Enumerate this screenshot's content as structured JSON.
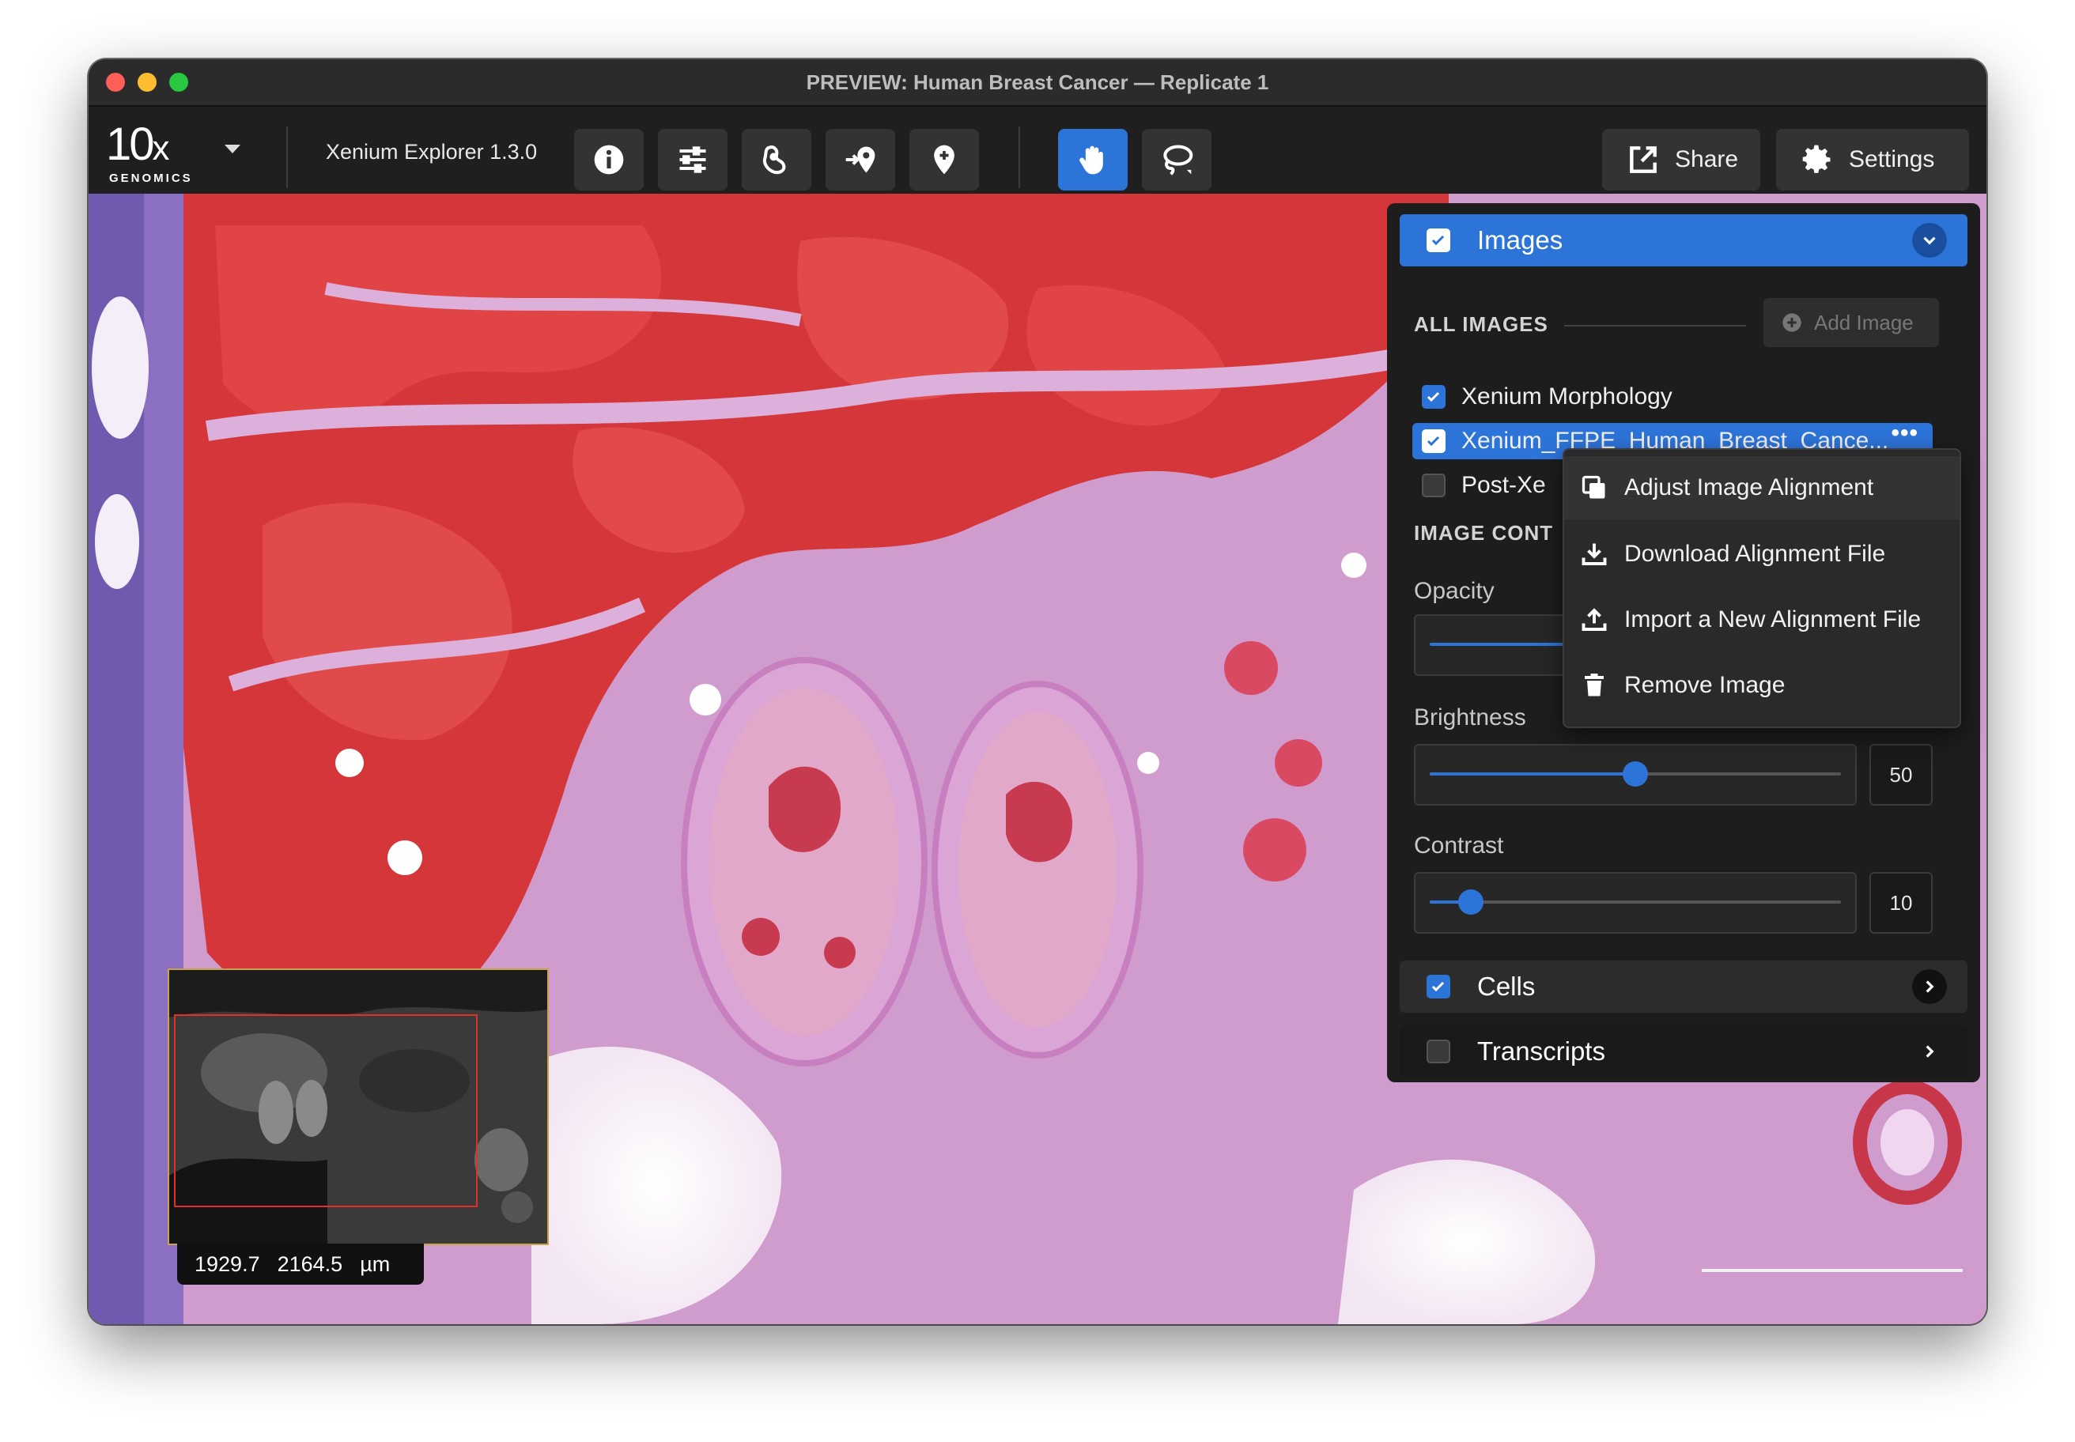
{
  "window": {
    "title": "PREVIEW: Human Breast Cancer — Replicate 1"
  },
  "logo": {
    "main": "10",
    "accent": "x",
    "sub": "GENOMICS"
  },
  "toolbar": {
    "app_version": "Xenium Explorer 1.3.0",
    "share_label": "Share",
    "settings_label": "Settings",
    "icons": [
      "info-icon",
      "sliders-icon",
      "cell-lasso-icon",
      "go-to-location-icon",
      "pin-icon",
      "hand-pan-icon",
      "lasso-icon"
    ]
  },
  "viewer": {
    "coord_x": "1929.7",
    "coord_y": "2164.5",
    "coord_unit": "µm"
  },
  "panel": {
    "images": {
      "title": "Images",
      "all_images_label": "ALL IMAGES",
      "add_image_label": "Add Image",
      "items": [
        {
          "label": "Xenium Morphology",
          "checked": true
        },
        {
          "label": "Xenium_FFPE_Human_Breast_Cance...",
          "checked": true,
          "selected": true
        },
        {
          "label": "Post-Xe",
          "checked": false
        }
      ],
      "image_controls_label": "IMAGE CONT",
      "opacity_label": "Opacity",
      "brightness_label": "Brightness",
      "brightness_value": "50",
      "brightness_fraction": 0.5,
      "contrast_label": "Contrast",
      "contrast_value": "10",
      "contrast_fraction": 0.1
    },
    "cells": {
      "title": "Cells",
      "checked": true
    },
    "transcripts": {
      "title": "Transcripts",
      "checked": false
    }
  },
  "context_menu": {
    "items": [
      {
        "label": "Adjust Image Alignment",
        "icon": "copy-icon"
      },
      {
        "label": "Download Alignment File",
        "icon": "download-icon"
      },
      {
        "label": "Import a New Alignment File",
        "icon": "upload-icon"
      },
      {
        "label": "Remove Image",
        "icon": "trash-icon"
      }
    ]
  },
  "colors": {
    "accent": "#2d74d9",
    "tissue_pink": "#c995c8",
    "cell_red": "#e0302a"
  }
}
